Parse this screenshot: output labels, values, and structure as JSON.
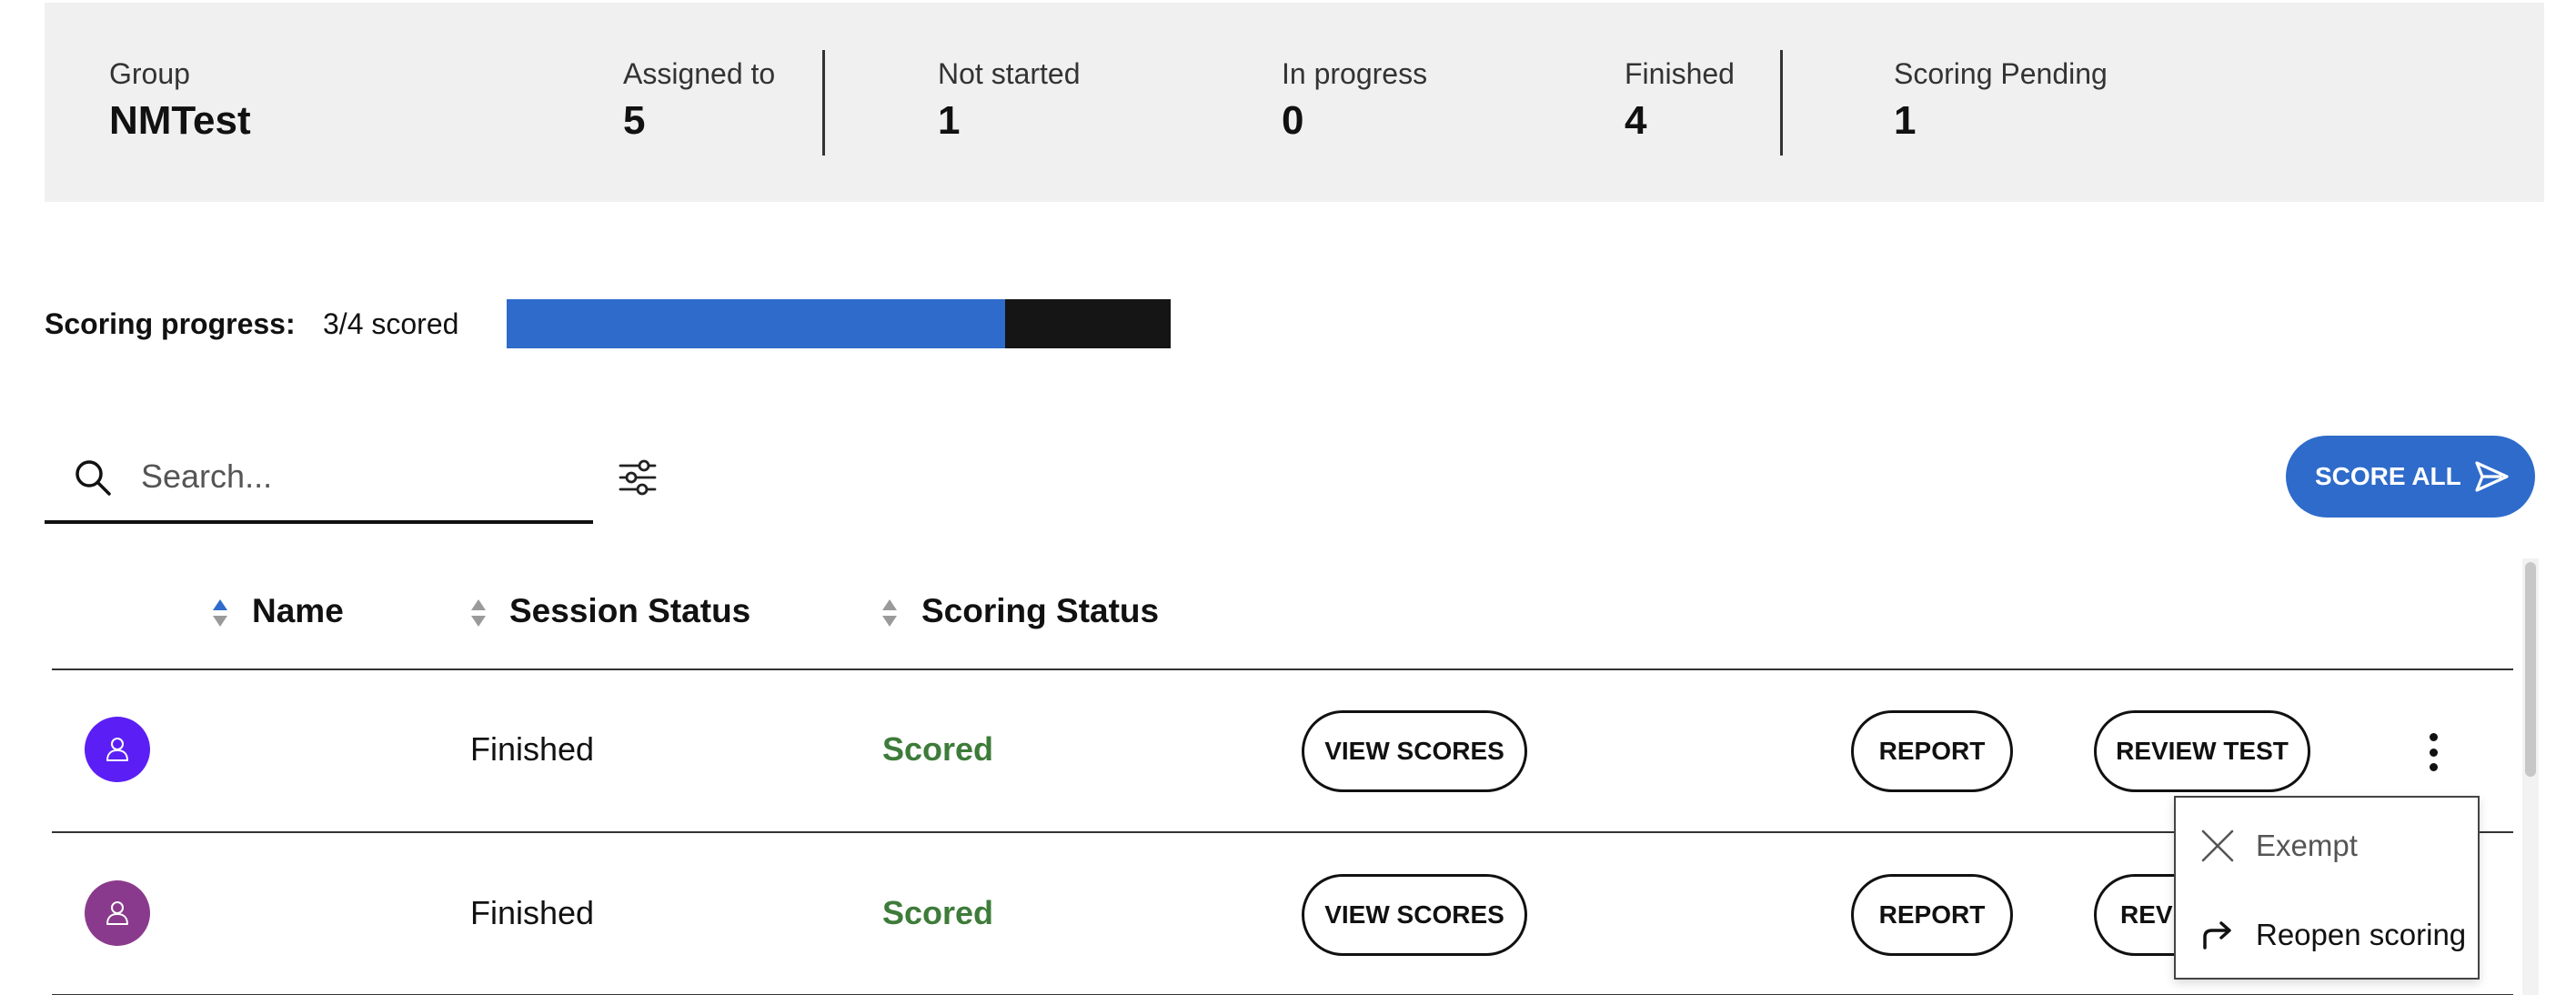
{
  "summary": {
    "group": {
      "label": "Group",
      "value": "NMTest"
    },
    "assigned_to": {
      "label": "Assigned to",
      "value": "5"
    },
    "not_started": {
      "label": "Not started",
      "value": "1"
    },
    "in_progress": {
      "label": "In progress",
      "value": "0"
    },
    "finished": {
      "label": "Finished",
      "value": "4"
    },
    "scoring_pending": {
      "label": "Scoring Pending",
      "value": "1"
    }
  },
  "scoring_progress": {
    "label": "Scoring progress:",
    "text": "3/4 scored",
    "scored": 3,
    "total": 4,
    "fill_color": "#2e6bcb",
    "track_color": "#151515"
  },
  "search": {
    "placeholder": "Search...",
    "value": "",
    "icon": "search-icon"
  },
  "filter": {
    "icon": "filter-sliders-icon"
  },
  "score_all": {
    "label": "SCORE ALL",
    "icon": "send-icon",
    "color": "#2e6bcb"
  },
  "table": {
    "columns": [
      {
        "label": "Name",
        "sort": "ascending"
      },
      {
        "label": "Session Status",
        "sort": "none"
      },
      {
        "label": "Scoring Status",
        "sort": "none"
      }
    ],
    "rows": [
      {
        "avatar_color": "#5b1ff5",
        "session_status": "Finished",
        "scoring_status": "Scored",
        "view_scores_label": "VIEW SCORES",
        "report_label": "REPORT",
        "review_test_label": "REVIEW TEST"
      },
      {
        "avatar_color": "#8a3a8c",
        "session_status": "Finished",
        "scoring_status": "Scored",
        "view_scores_label": "VIEW SCORES",
        "report_label": "REPORT",
        "review_test_label": "REV"
      }
    ]
  },
  "row_menu": {
    "items": [
      {
        "label": "Exempt",
        "icon": "close-icon",
        "disabled": true
      },
      {
        "label": "Reopen scoring",
        "icon": "reopen-arrow-icon",
        "disabled": false
      }
    ]
  },
  "colors": {
    "accent": "#2e6bcb",
    "scored_green": "#3e7b3a",
    "summary_bg": "#f0f0f0"
  }
}
